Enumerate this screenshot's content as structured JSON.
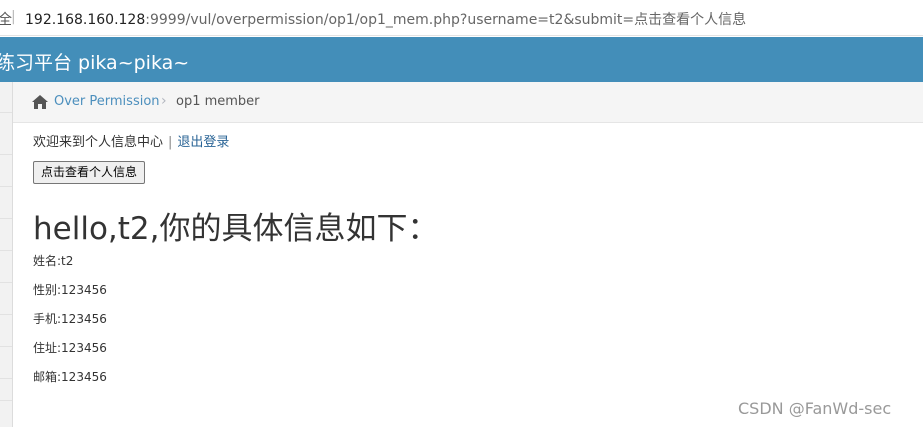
{
  "browser": {
    "prefix": "全",
    "separator": "|",
    "url_host": "192.168.160.128",
    "url_path": ":9999/vul/overpermission/op1/op1_mem.php?username=t2&submit=点击查看个人信息"
  },
  "navbar": {
    "brand": "练习平台 pika~pika~",
    "color": "#438eb9"
  },
  "breadcrumb": {
    "home_icon": "home-icon",
    "link": "Over Permission",
    "separator": "›",
    "current": "op1 member"
  },
  "content": {
    "welcome_text": "欢迎来到个人信息中心",
    "pipe": "|",
    "logout_link": "退出登录",
    "view_button": "点击查看个人信息",
    "hello_heading": "hello,t2,你的具体信息如下：",
    "fields": [
      {
        "label": "姓名:t2"
      },
      {
        "label": "性别:123456"
      },
      {
        "label": "手机:123456"
      },
      {
        "label": "住址:123456"
      },
      {
        "label": "邮箱:123456"
      }
    ]
  },
  "watermark": "CSDN @FanWd-sec"
}
